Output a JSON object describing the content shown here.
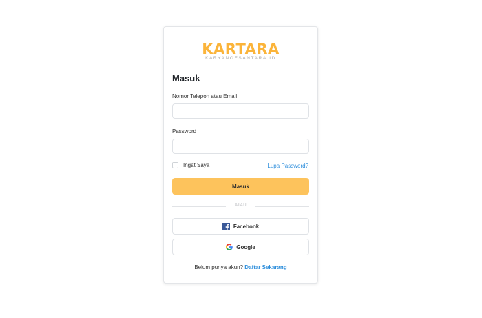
{
  "logo": {
    "name": "KARTARA",
    "tagline": "KARYANOESANTARA.ID"
  },
  "form": {
    "title": "Masuk",
    "identifier_label": "Nomor Telepon atau Email",
    "identifier_value": "",
    "identifier_placeholder": "",
    "password_label": "Password",
    "password_value": "",
    "password_placeholder": "",
    "remember_label": "Ingat Saya",
    "remember_checked": false,
    "forgot_label": "Lupa Password?",
    "submit_label": "Masuk",
    "divider_label": "ATAU"
  },
  "social": {
    "facebook_label": "Facebook",
    "google_label": "Google"
  },
  "signup": {
    "prompt": "Belum punya akun?",
    "link_label": "Daftar Sekarang"
  },
  "colors": {
    "brand": "#fbb43a",
    "primary_button": "#fdc35c",
    "link": "#2f8fdc",
    "facebook": "#3b5998"
  }
}
